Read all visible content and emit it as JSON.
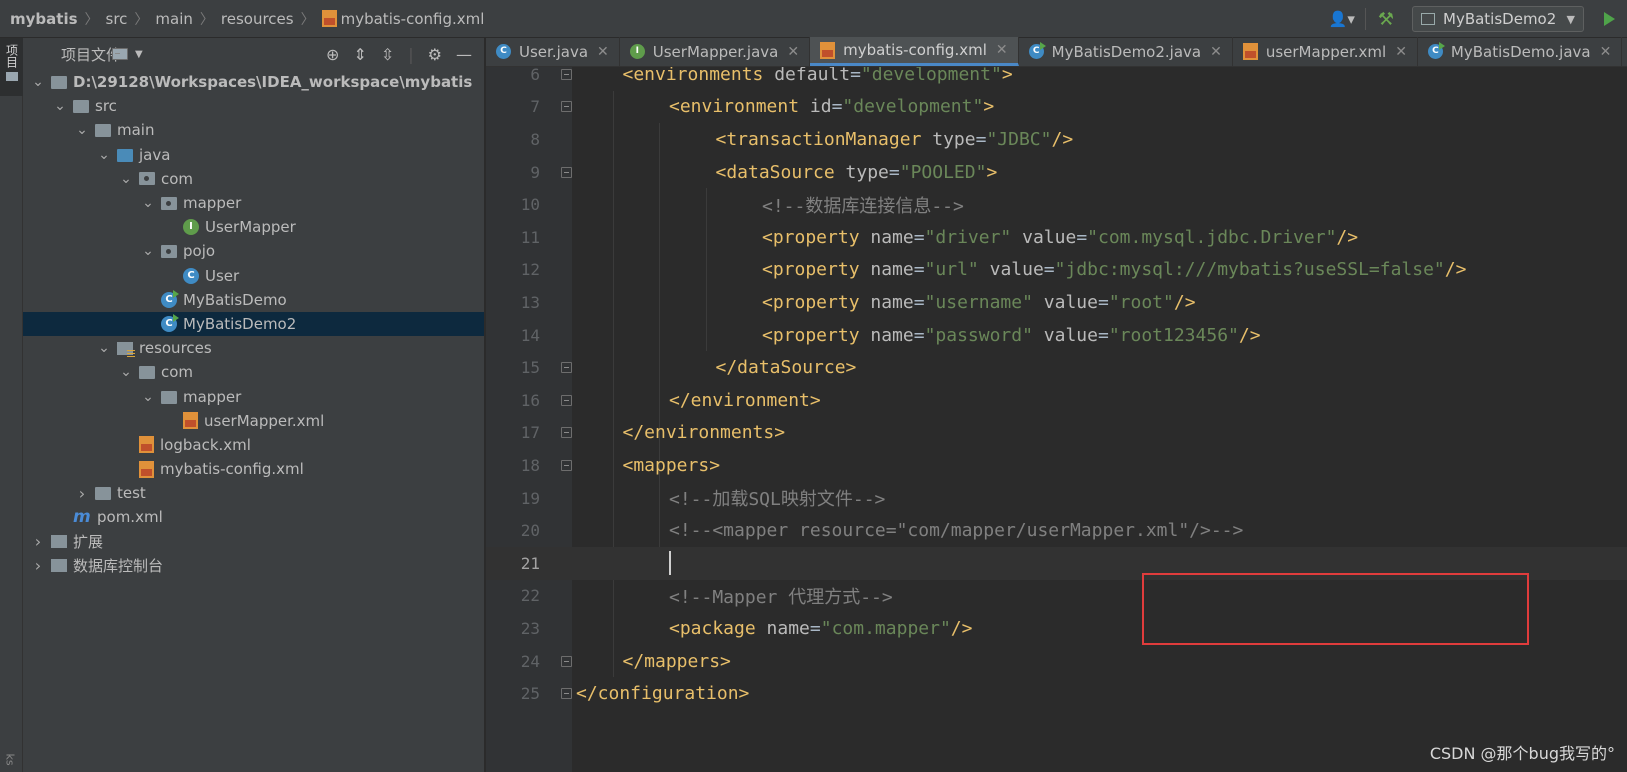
{
  "breadcrumbs": [
    "mybatis",
    "src",
    "main",
    "resources",
    "mybatis-config.xml"
  ],
  "run_config": "MyBatisDemo2",
  "left_strip": {
    "project_tab": "项目",
    "bottom_tab": "ks"
  },
  "project_panel": {
    "title": "项目文件",
    "tree": [
      {
        "label": "D:\\29128\\Workspaces\\IDEA_workspace\\mybatis",
        "icon": "folder-icon",
        "depth": 0,
        "expanded": true
      },
      {
        "label": "src",
        "icon": "folder-icon",
        "depth": 1,
        "expanded": true
      },
      {
        "label": "main",
        "icon": "folder-icon",
        "depth": 2,
        "expanded": true
      },
      {
        "label": "java",
        "icon": "source-folder-icon",
        "depth": 3,
        "expanded": true
      },
      {
        "label": "com",
        "icon": "package-icon",
        "depth": 4,
        "expanded": true
      },
      {
        "label": "mapper",
        "icon": "package-icon",
        "depth": 5,
        "expanded": true
      },
      {
        "label": "UserMapper",
        "icon": "interface-icon",
        "depth": 6
      },
      {
        "label": "pojo",
        "icon": "package-icon",
        "depth": 5,
        "expanded": true
      },
      {
        "label": "User",
        "icon": "class-icon",
        "depth": 6
      },
      {
        "label": "MyBatisDemo",
        "icon": "runnable-class-icon",
        "depth": 5
      },
      {
        "label": "MyBatisDemo2",
        "icon": "runnable-class-icon",
        "depth": 5,
        "selected": true
      },
      {
        "label": "resources",
        "icon": "resources-folder-icon",
        "depth": 3,
        "expanded": true
      },
      {
        "label": "com",
        "icon": "folder-icon",
        "depth": 4,
        "expanded": true
      },
      {
        "label": "mapper",
        "icon": "folder-icon",
        "depth": 5,
        "expanded": true
      },
      {
        "label": "userMapper.xml",
        "icon": "xml-file-icon",
        "depth": 6
      },
      {
        "label": "logback.xml",
        "icon": "xml-file-icon",
        "depth": 4
      },
      {
        "label": "mybatis-config.xml",
        "icon": "xml-file-icon",
        "depth": 4
      },
      {
        "label": "test",
        "icon": "folder-icon",
        "depth": 2,
        "expanded": false
      },
      {
        "label": "pom.xml",
        "icon": "maven-icon",
        "depth": 1
      },
      {
        "label": "扩展",
        "icon": "library-icon",
        "depth": 0,
        "expanded": false
      },
      {
        "label": "数据库控制台",
        "icon": "library-icon",
        "depth": 0,
        "expanded": false
      }
    ]
  },
  "tabs": [
    {
      "label": "User.java",
      "icon": "class-icon"
    },
    {
      "label": "UserMapper.java",
      "icon": "interface-icon"
    },
    {
      "label": "mybatis-config.xml",
      "icon": "xml-file-icon",
      "active": true
    },
    {
      "label": "MyBatisDemo2.java",
      "icon": "runnable-class-icon"
    },
    {
      "label": "userMapper.xml",
      "icon": "xml-file-icon"
    },
    {
      "label": "MyBatisDemo.java",
      "icon": "runnable-class-icon"
    }
  ],
  "editor": {
    "current_line": 21,
    "lines": [
      {
        "n": "6",
        "indent": 1,
        "tokens": [
          [
            "tg",
            "<environments "
          ],
          [
            "at",
            "default"
          ],
          [
            "eq",
            "="
          ],
          [
            "vl",
            "\"development\""
          ],
          [
            "tg",
            ">"
          ]
        ]
      },
      {
        "n": "7",
        "indent": 2,
        "tokens": [
          [
            "tg",
            "<environment "
          ],
          [
            "at",
            "id"
          ],
          [
            "eq",
            "="
          ],
          [
            "vl",
            "\"development\""
          ],
          [
            "tg",
            ">"
          ]
        ]
      },
      {
        "n": "8",
        "indent": 3,
        "tokens": [
          [
            "tg",
            "<transactionManager "
          ],
          [
            "at",
            "type"
          ],
          [
            "eq",
            "="
          ],
          [
            "vl",
            "\"JDBC\""
          ],
          [
            "tg",
            "/>"
          ]
        ]
      },
      {
        "n": "9",
        "indent": 3,
        "tokens": [
          [
            "tg",
            "<dataSource "
          ],
          [
            "at",
            "type"
          ],
          [
            "eq",
            "="
          ],
          [
            "vl",
            "\"POOLED\""
          ],
          [
            "tg",
            ">"
          ]
        ]
      },
      {
        "n": "10",
        "indent": 4,
        "tokens": [
          [
            "cm",
            "<!--数据库连接信息-->"
          ]
        ]
      },
      {
        "n": "11",
        "indent": 4,
        "tokens": [
          [
            "tg",
            "<property "
          ],
          [
            "at",
            "name"
          ],
          [
            "eq",
            "="
          ],
          [
            "vl",
            "\"driver\""
          ],
          [
            "eq",
            " "
          ],
          [
            "at",
            "value"
          ],
          [
            "eq",
            "="
          ],
          [
            "vl",
            "\"com.mysql.jdbc.Driver\""
          ],
          [
            "tg",
            "/>"
          ]
        ]
      },
      {
        "n": "12",
        "indent": 4,
        "tokens": [
          [
            "tg",
            "<property "
          ],
          [
            "at",
            "name"
          ],
          [
            "eq",
            "="
          ],
          [
            "vl",
            "\"url\""
          ],
          [
            "eq",
            " "
          ],
          [
            "at",
            "value"
          ],
          [
            "eq",
            "="
          ],
          [
            "vl",
            "\"jdbc:mysql:///mybatis?useSSL=false\""
          ],
          [
            "tg",
            "/>"
          ]
        ]
      },
      {
        "n": "13",
        "indent": 4,
        "tokens": [
          [
            "tg",
            "<property "
          ],
          [
            "at",
            "name"
          ],
          [
            "eq",
            "="
          ],
          [
            "vl",
            "\"username\""
          ],
          [
            "eq",
            " "
          ],
          [
            "at",
            "value"
          ],
          [
            "eq",
            "="
          ],
          [
            "vl",
            "\"root\""
          ],
          [
            "tg",
            "/>"
          ]
        ]
      },
      {
        "n": "14",
        "indent": 4,
        "tokens": [
          [
            "tg",
            "<property "
          ],
          [
            "at",
            "name"
          ],
          [
            "eq",
            "="
          ],
          [
            "vl",
            "\"password\""
          ],
          [
            "eq",
            " "
          ],
          [
            "at",
            "value"
          ],
          [
            "eq",
            "="
          ],
          [
            "vl",
            "\"root123456\""
          ],
          [
            "tg",
            "/>"
          ]
        ]
      },
      {
        "n": "15",
        "indent": 3,
        "tokens": [
          [
            "tg",
            "</dataSource>"
          ]
        ]
      },
      {
        "n": "16",
        "indent": 2,
        "tokens": [
          [
            "tg",
            "</environment>"
          ]
        ]
      },
      {
        "n": "17",
        "indent": 1,
        "tokens": [
          [
            "tg",
            "</environments>"
          ]
        ]
      },
      {
        "n": "18",
        "indent": 1,
        "tokens": [
          [
            "tg",
            "<mappers>"
          ]
        ]
      },
      {
        "n": "19",
        "indent": 2,
        "tokens": [
          [
            "cm",
            "<!--加载SQL映射文件-->"
          ]
        ]
      },
      {
        "n": "20",
        "indent": 2,
        "tokens": [
          [
            "cm",
            "<!--<mapper resource=\"com/mapper/userMapper.xml\"/>-->"
          ]
        ]
      },
      {
        "n": "21",
        "indent": 2,
        "tokens": []
      },
      {
        "n": "22",
        "indent": 2,
        "tokens": [
          [
            "cm",
            "<!--Mapper 代理方式-->"
          ]
        ]
      },
      {
        "n": "23",
        "indent": 2,
        "tokens": [
          [
            "tg",
            "<package "
          ],
          [
            "at",
            "name"
          ],
          [
            "eq",
            "="
          ],
          [
            "vl",
            "\"com.mapper\""
          ],
          [
            "tg",
            "/>"
          ]
        ]
      },
      {
        "n": "24",
        "indent": 1,
        "tokens": [
          [
            "tg",
            "</mappers>"
          ]
        ]
      },
      {
        "n": "25",
        "indent": 0,
        "tokens": [
          [
            "tg",
            "</configuration>"
          ]
        ]
      }
    ],
    "fold_lines": [
      "6",
      "7",
      "9",
      "15",
      "16",
      "17",
      "18",
      "24",
      "25"
    ]
  },
  "watermark": "CSDN @那个bug我写的°"
}
